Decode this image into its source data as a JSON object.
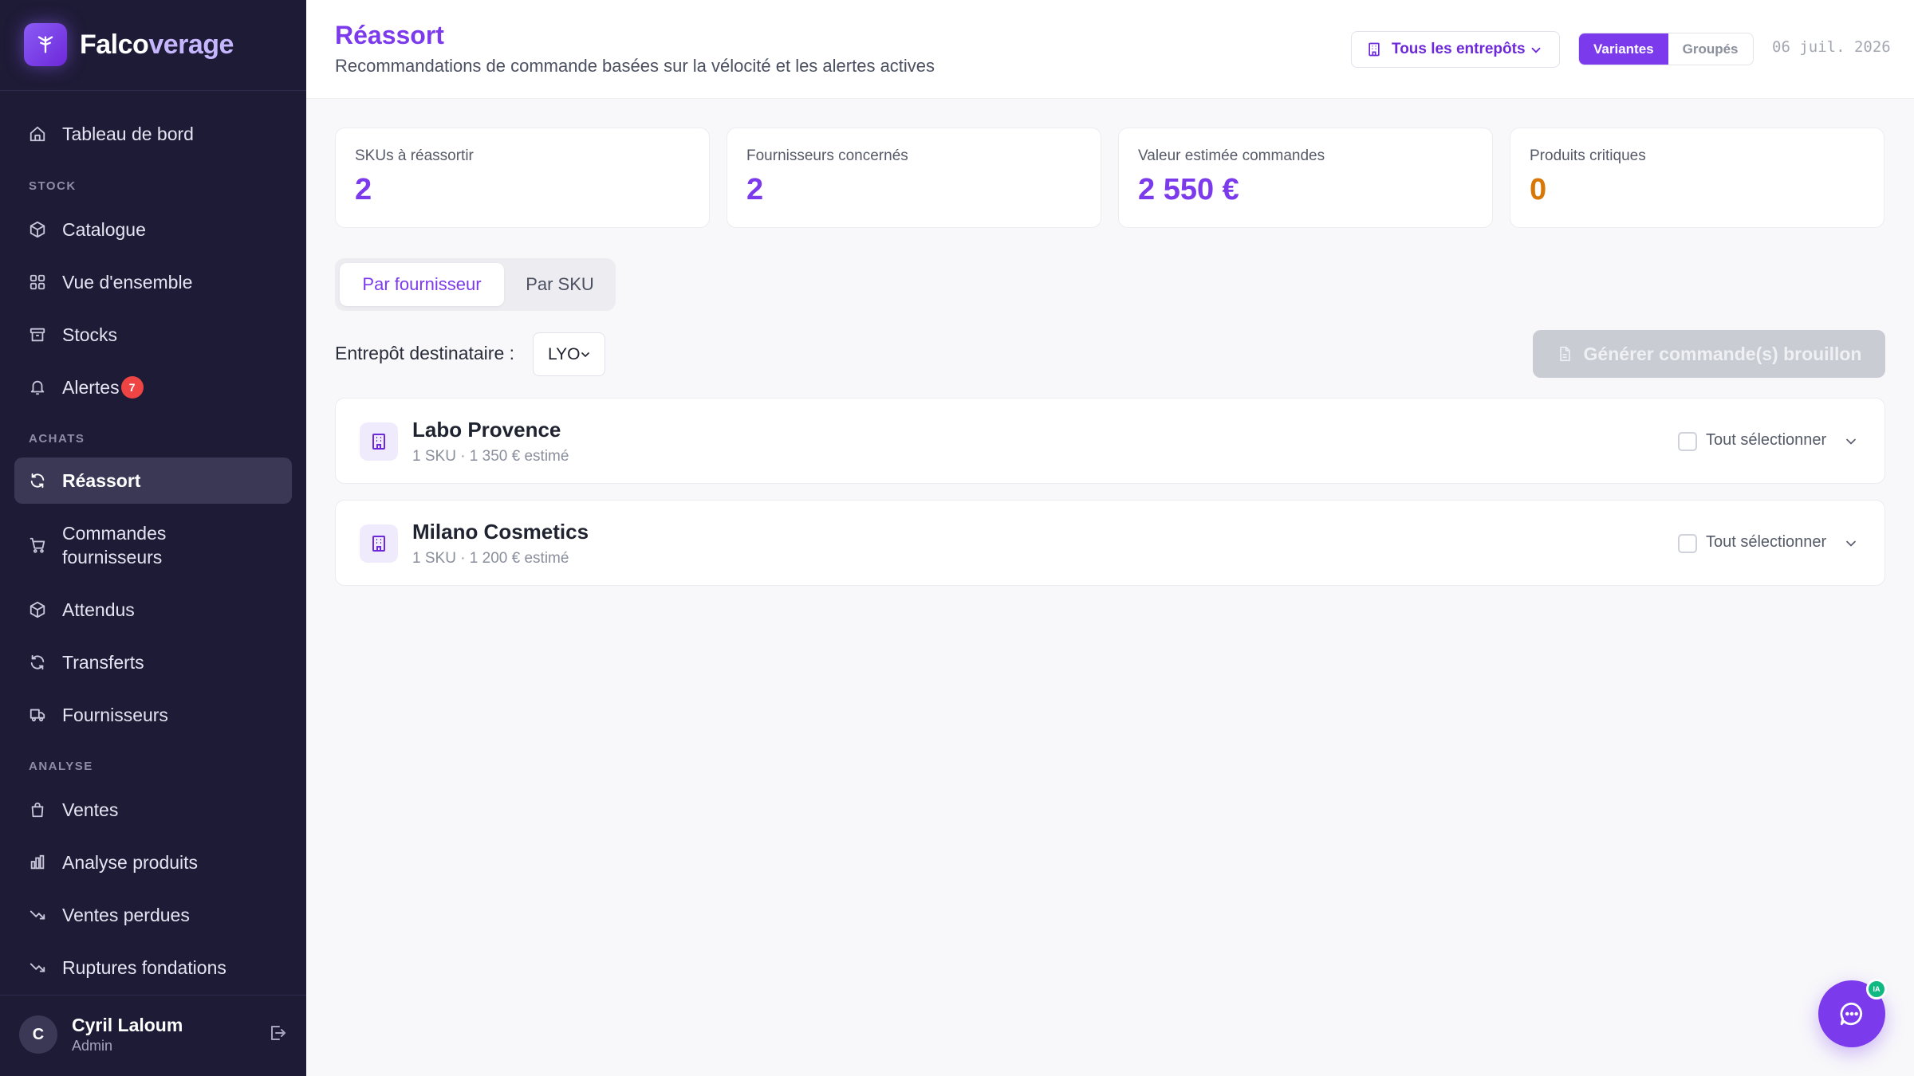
{
  "app": {
    "name_main": "Falco",
    "name_accent": "verage"
  },
  "sidebar": {
    "dashboard": "Tableau de bord",
    "sections": {
      "stock": "STOCK",
      "achats": "ACHATS",
      "analyse": "ANALYSE"
    },
    "items": {
      "catalogue": "Catalogue",
      "overview": "Vue d'ensemble",
      "stocks": "Stocks",
      "alertes": "Alertes",
      "alertes_count": "7",
      "reassort": "Réassort",
      "commandes_line1": "Commandes",
      "commandes_line2": "fournisseurs",
      "attendus": "Attendus",
      "transferts": "Transferts",
      "fournisseurs": "Fournisseurs",
      "ventes": "Ventes",
      "analyse_produits": "Analyse produits",
      "ventes_perdues": "Ventes perdues",
      "ruptures": "Ruptures fondations"
    },
    "user": {
      "initial": "C",
      "name": "Cyril Laloum",
      "role": "Admin"
    }
  },
  "header": {
    "title": "Réassort",
    "subtitle": "Recommandations de commande basées sur la vélocité et les alertes actives",
    "warehouse_select": "Tous les entrepôts",
    "view_variants": "Variantes",
    "view_grouped": "Groupés",
    "date": "06 juil. 2026"
  },
  "stats": [
    {
      "label": "SKUs à réassortir",
      "value": "2"
    },
    {
      "label": "Fournisseurs concernés",
      "value": "2"
    },
    {
      "label": "Valeur estimée commandes",
      "value": "2 550 €"
    },
    {
      "label": "Produits critiques",
      "value": "0"
    }
  ],
  "tabs": {
    "by_supplier": "Par fournisseur",
    "by_sku": "Par SKU"
  },
  "destination": {
    "label": "Entrepôt destinataire :",
    "value": "LYO"
  },
  "generate_button": "Générer commande(s) brouillon",
  "suppliers": [
    {
      "name": "Labo Provence",
      "meta": "1 SKU · 1 350 € estimé",
      "select_all": "Tout sélectionner"
    },
    {
      "name": "Milano Cosmetics",
      "meta": "1 SKU · 1 200 € estimé",
      "select_all": "Tout sélectionner"
    }
  ],
  "chat": {
    "badge": "IA"
  },
  "colors": {
    "accent": "#7c3aed",
    "sidebar_bg": "#1e1b36",
    "warning": "#d97706",
    "alert_badge": "#ef4444",
    "online": "#10b981"
  }
}
